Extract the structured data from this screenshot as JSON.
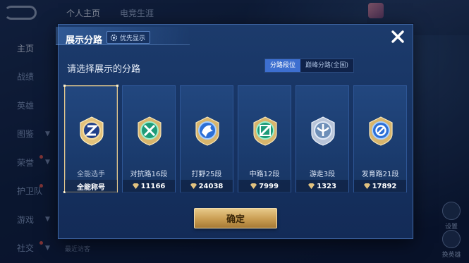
{
  "background": {
    "top_tabs": [
      "个人主页",
      "电竞生涯"
    ],
    "side_nav": [
      {
        "label": "主页",
        "active": true
      },
      {
        "label": "战绩"
      },
      {
        "label": "英雄"
      },
      {
        "label": "图鉴"
      },
      {
        "label": "荣誉",
        "dot": true
      },
      {
        "label": "护卫队",
        "dot": true
      },
      {
        "label": "游戏"
      },
      {
        "label": "社交",
        "dot": true
      }
    ],
    "visitors_label": "最近访客",
    "right_buttons": [
      "设置",
      "换英雄"
    ]
  },
  "dialog": {
    "title": "展示分路",
    "priority_tag": "优先显示",
    "subtitle": "请选择展示的分路",
    "toggle": {
      "options": [
        "分路段位",
        "巅峰分路(全国)"
      ],
      "active_index": 0
    },
    "cards": [
      {
        "name": "全能选手",
        "value": "全能称号",
        "medal": "gold-all-round",
        "selected": true
      },
      {
        "name": "对抗路16段",
        "value": "11166",
        "medal": "green-clash"
      },
      {
        "name": "打野25段",
        "value": "24038",
        "medal": "blue-jungle"
      },
      {
        "name": "中路12段",
        "value": "7999",
        "medal": "green-mid"
      },
      {
        "name": "游走3段",
        "value": "1323",
        "medal": "silver-roam"
      },
      {
        "name": "发育路21段",
        "value": "17892",
        "medal": "blue-farm"
      }
    ],
    "confirm_label": "确定"
  },
  "colors": {
    "accent": "#3d6fd0",
    "gold": "#d4ae68",
    "dialog_bg": "#173565"
  }
}
